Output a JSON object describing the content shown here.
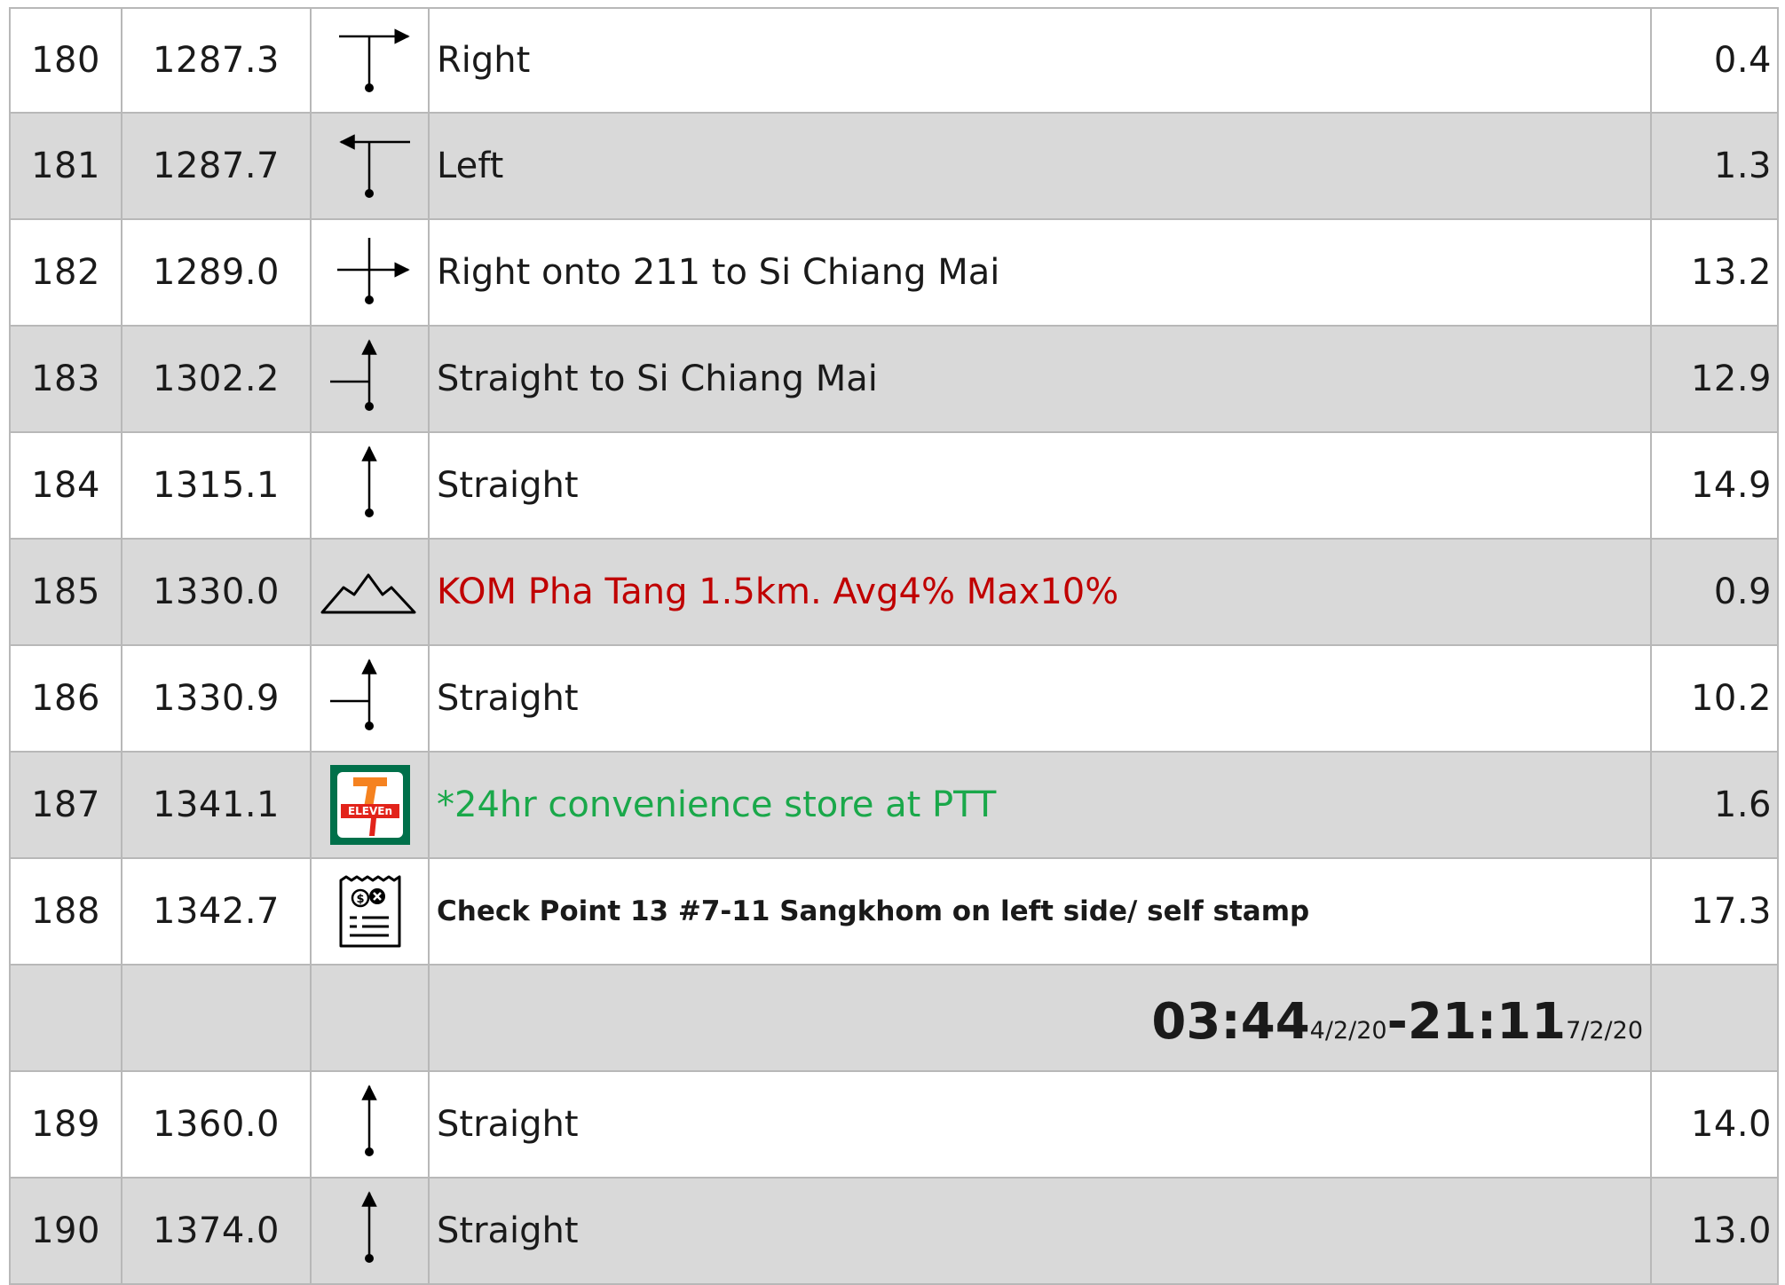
{
  "rows": [
    {
      "no": "180",
      "km": "1287.3",
      "icon": "t-junction-right-icon",
      "desc": "Right",
      "dist": "0.4"
    },
    {
      "no": "181",
      "km": "1287.7",
      "icon": "t-junction-left-icon",
      "desc": "Left",
      "dist": "1.3"
    },
    {
      "no": "182",
      "km": "1289.0",
      "icon": "crossroad-right-icon",
      "desc": "Right onto 211 to Si Chiang Mai",
      "dist": "13.2"
    },
    {
      "no": "183",
      "km": "1302.2",
      "icon": "junction-straight-icon",
      "desc": "Straight to Si Chiang Mai",
      "dist": "12.9"
    },
    {
      "no": "184",
      "km": "1315.1",
      "icon": "straight-arrow-icon",
      "desc": "Straight",
      "dist": "14.9"
    },
    {
      "no": "185",
      "km": "1330.0",
      "icon": "mountain-icon",
      "desc": "KOM Pha Tang 1.5km. Avg4% Max10%",
      "dist": "0.9",
      "color": "#c00000"
    },
    {
      "no": "186",
      "km": "1330.9",
      "icon": "junction-straight-icon",
      "desc": "Straight",
      "dist": "10.2"
    },
    {
      "no": "187",
      "km": "1341.1",
      "icon": "seven-eleven-logo",
      "desc": "*24hr convenience store at PTT",
      "dist": "1.6",
      "color": "#1aa84a",
      "logo_text": "ELEVEn"
    },
    {
      "no": "188",
      "km": "1342.7",
      "icon": "receipt-icon",
      "desc": "Check Point 13 #7-11 Sangkhom on left side/ self stamp",
      "dist": "17.3"
    },
    {
      "no": "189",
      "km": "1360.0",
      "icon": "straight-arrow-icon",
      "desc": "Straight",
      "dist": "14.0"
    },
    {
      "no": "190",
      "km": "1374.0",
      "icon": "straight-arrow-icon",
      "desc": "Straight",
      "dist": "13.0"
    }
  ],
  "checkpoint_time": {
    "open_time": "03:44",
    "open_date": "4/2/20",
    "separator": "-",
    "close_time": "21:11",
    "close_date": "7/2/20"
  },
  "colors": {
    "grey_row": "#d9d9d9",
    "red_text": "#c00000",
    "green_text": "#1aa84a",
    "seven_eleven_green": "#00704a",
    "seven_eleven_orange": "#f58220",
    "seven_eleven_red": "#e2231a"
  }
}
